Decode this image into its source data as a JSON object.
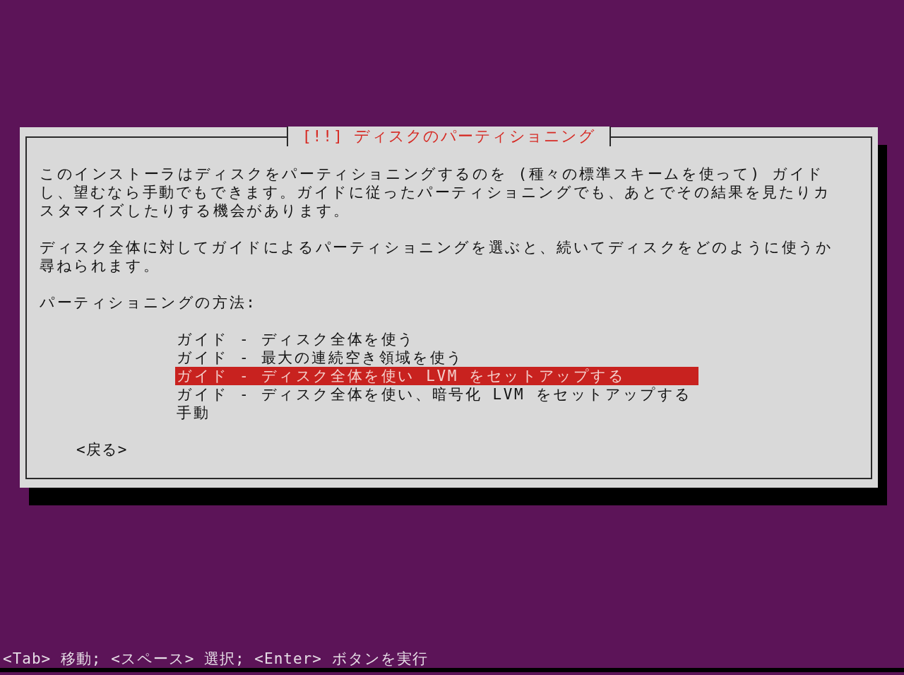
{
  "dialog": {
    "title": "[!!] ディスクのパーティショニング",
    "paragraphs": [
      "このインストーラはディスクをパーティショニングするのを (種々の標準スキームを使って) ガイドし、望むなら手動でもできます。ガイドに従ったパーティショニングでも、あとでその結果を見たりカスタマイズしたりする機会があります。",
      "ディスク全体に対してガイドによるパーティショニングを選ぶと、続いてディスクをどのように使うか尋ねられます。"
    ],
    "prompt": "パーティショニングの方法:",
    "options": [
      {
        "label": "ガイド - ディスク全体を使う",
        "selected": false
      },
      {
        "label": "ガイド - 最大の連続空き領域を使う",
        "selected": false
      },
      {
        "label": "ガイド - ディスク全体を使い LVM をセットアップする",
        "selected": true
      },
      {
        "label": "ガイド - ディスク全体を使い、暗号化 LVM をセットアップする",
        "selected": false
      },
      {
        "label": "手動",
        "selected": false
      }
    ],
    "back_button": "<戻る>"
  },
  "status_bar": "<Tab> 移動; <スペース> 選択; <Enter> ボタンを実行"
}
